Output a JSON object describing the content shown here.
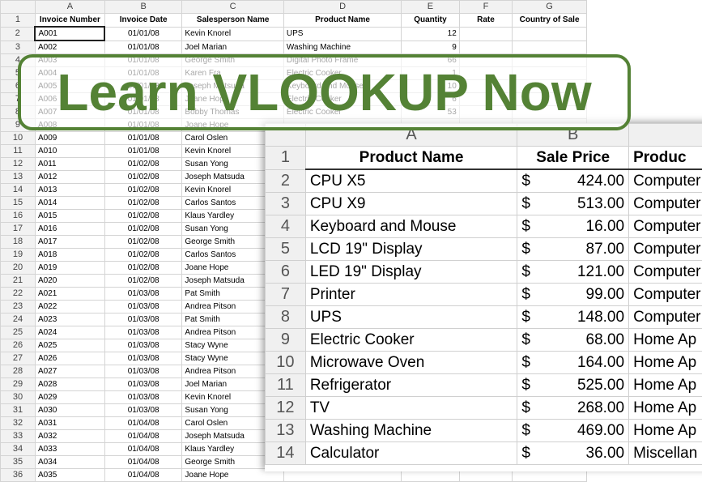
{
  "back_sheet": {
    "columns": [
      "A",
      "B",
      "C",
      "D",
      "E",
      "F",
      "G"
    ],
    "headers": [
      "Invoice Number",
      "Invoice Date",
      "Salesperson Name",
      "Product Name",
      "Quantity",
      "Rate",
      "Country of Sale"
    ],
    "rows": [
      [
        "2",
        "A001",
        "01/01/08",
        "Kevin Knorel",
        "UPS",
        "12"
      ],
      [
        "3",
        "A002",
        "01/01/08",
        "Joel Marian",
        "Washing Machine",
        "9"
      ],
      [
        "4",
        "A003",
        "01/01/08",
        "George Smith",
        "Digital Photo Frame",
        "66"
      ],
      [
        "5",
        "A004",
        "01/01/08",
        "Karen Fra",
        "Electric Cooker",
        "1"
      ],
      [
        "6",
        "A005",
        "01/01/08",
        "Joseph Matsuda",
        "Keyboard and Mouse",
        "10"
      ],
      [
        "7",
        "A006",
        "01/01/08",
        "Joane Hope",
        "Electric Cooker",
        "6"
      ],
      [
        "8",
        "A007",
        "01/01/08",
        "Bobby Thomas",
        "Electric Cooker",
        "53"
      ],
      [
        "9",
        "A008",
        "01/01/08",
        "Joane Hope",
        "",
        ""
      ],
      [
        "10",
        "A009",
        "01/01/08",
        "Carol Oslen",
        "",
        ""
      ],
      [
        "11",
        "A010",
        "01/01/08",
        "Kevin Knorel",
        "",
        ""
      ],
      [
        "12",
        "A011",
        "01/02/08",
        "Susan Yong",
        "",
        ""
      ],
      [
        "13",
        "A012",
        "01/02/08",
        "Joseph Matsuda",
        "",
        ""
      ],
      [
        "14",
        "A013",
        "01/02/08",
        "Kevin Knorel",
        "",
        ""
      ],
      [
        "15",
        "A014",
        "01/02/08",
        "Carlos Santos",
        "",
        ""
      ],
      [
        "16",
        "A015",
        "01/02/08",
        "Klaus Yardley",
        "",
        ""
      ],
      [
        "17",
        "A016",
        "01/02/08",
        "Susan Yong",
        "",
        ""
      ],
      [
        "18",
        "A017",
        "01/02/08",
        "George Smith",
        "",
        ""
      ],
      [
        "19",
        "A018",
        "01/02/08",
        "Carlos Santos",
        "",
        ""
      ],
      [
        "20",
        "A019",
        "01/02/08",
        "Joane Hope",
        "",
        ""
      ],
      [
        "21",
        "A020",
        "01/02/08",
        "Joseph Matsuda",
        "",
        ""
      ],
      [
        "22",
        "A021",
        "01/03/08",
        "Pat Smith",
        "",
        ""
      ],
      [
        "23",
        "A022",
        "01/03/08",
        "Andrea Pitson",
        "",
        ""
      ],
      [
        "24",
        "A023",
        "01/03/08",
        "Pat Smith",
        "",
        ""
      ],
      [
        "25",
        "A024",
        "01/03/08",
        "Andrea Pitson",
        "",
        ""
      ],
      [
        "26",
        "A025",
        "01/03/08",
        "Stacy Wyne",
        "",
        ""
      ],
      [
        "27",
        "A026",
        "01/03/08",
        "Stacy Wyne",
        "",
        ""
      ],
      [
        "28",
        "A027",
        "01/03/08",
        "Andrea Pitson",
        "",
        ""
      ],
      [
        "29",
        "A028",
        "01/03/08",
        "Joel Marian",
        "",
        ""
      ],
      [
        "30",
        "A029",
        "01/03/08",
        "Kevin Knorel",
        "",
        ""
      ],
      [
        "31",
        "A030",
        "01/03/08",
        "Susan Yong",
        "",
        ""
      ],
      [
        "32",
        "A031",
        "01/04/08",
        "Carol Oslen",
        "",
        ""
      ],
      [
        "33",
        "A032",
        "01/04/08",
        "Joseph Matsuda",
        "",
        ""
      ],
      [
        "34",
        "A033",
        "01/04/08",
        "Klaus Yardley",
        "",
        ""
      ],
      [
        "35",
        "A034",
        "01/04/08",
        "George Smith",
        "",
        ""
      ],
      [
        "36",
        "A035",
        "01/04/08",
        "Joane Hope",
        "",
        ""
      ]
    ]
  },
  "front_sheet": {
    "columns": [
      "A",
      "B"
    ],
    "headers": [
      "Product Name",
      "Sale Price",
      "Produc"
    ],
    "currency_symbol": "$",
    "rows": [
      [
        "2",
        "CPU X5",
        "424.00",
        "Computer"
      ],
      [
        "3",
        "CPU X9",
        "513.00",
        "Computer"
      ],
      [
        "4",
        "Keyboard and Mouse",
        "16.00",
        "Computer"
      ],
      [
        "5",
        "LCD 19\" Display",
        "87.00",
        "Computer"
      ],
      [
        "6",
        "LED 19\" Display",
        "121.00",
        "Computer"
      ],
      [
        "7",
        "Printer",
        "99.00",
        "Computer"
      ],
      [
        "8",
        "UPS",
        "148.00",
        "Computer"
      ],
      [
        "9",
        "Electric Cooker",
        "68.00",
        "Home Ap"
      ],
      [
        "10",
        "Microwave Oven",
        "164.00",
        "Home Ap"
      ],
      [
        "11",
        "Refrigerator",
        "525.00",
        "Home Ap"
      ],
      [
        "12",
        "TV",
        "268.00",
        "Home Ap"
      ],
      [
        "13",
        "Washing Machine",
        "469.00",
        "Home Ap"
      ],
      [
        "14",
        "Calculator",
        "36.00",
        "Miscellan"
      ]
    ]
  },
  "banner": {
    "text": "Learn VLOOKUP Now",
    "color": "#548235"
  }
}
